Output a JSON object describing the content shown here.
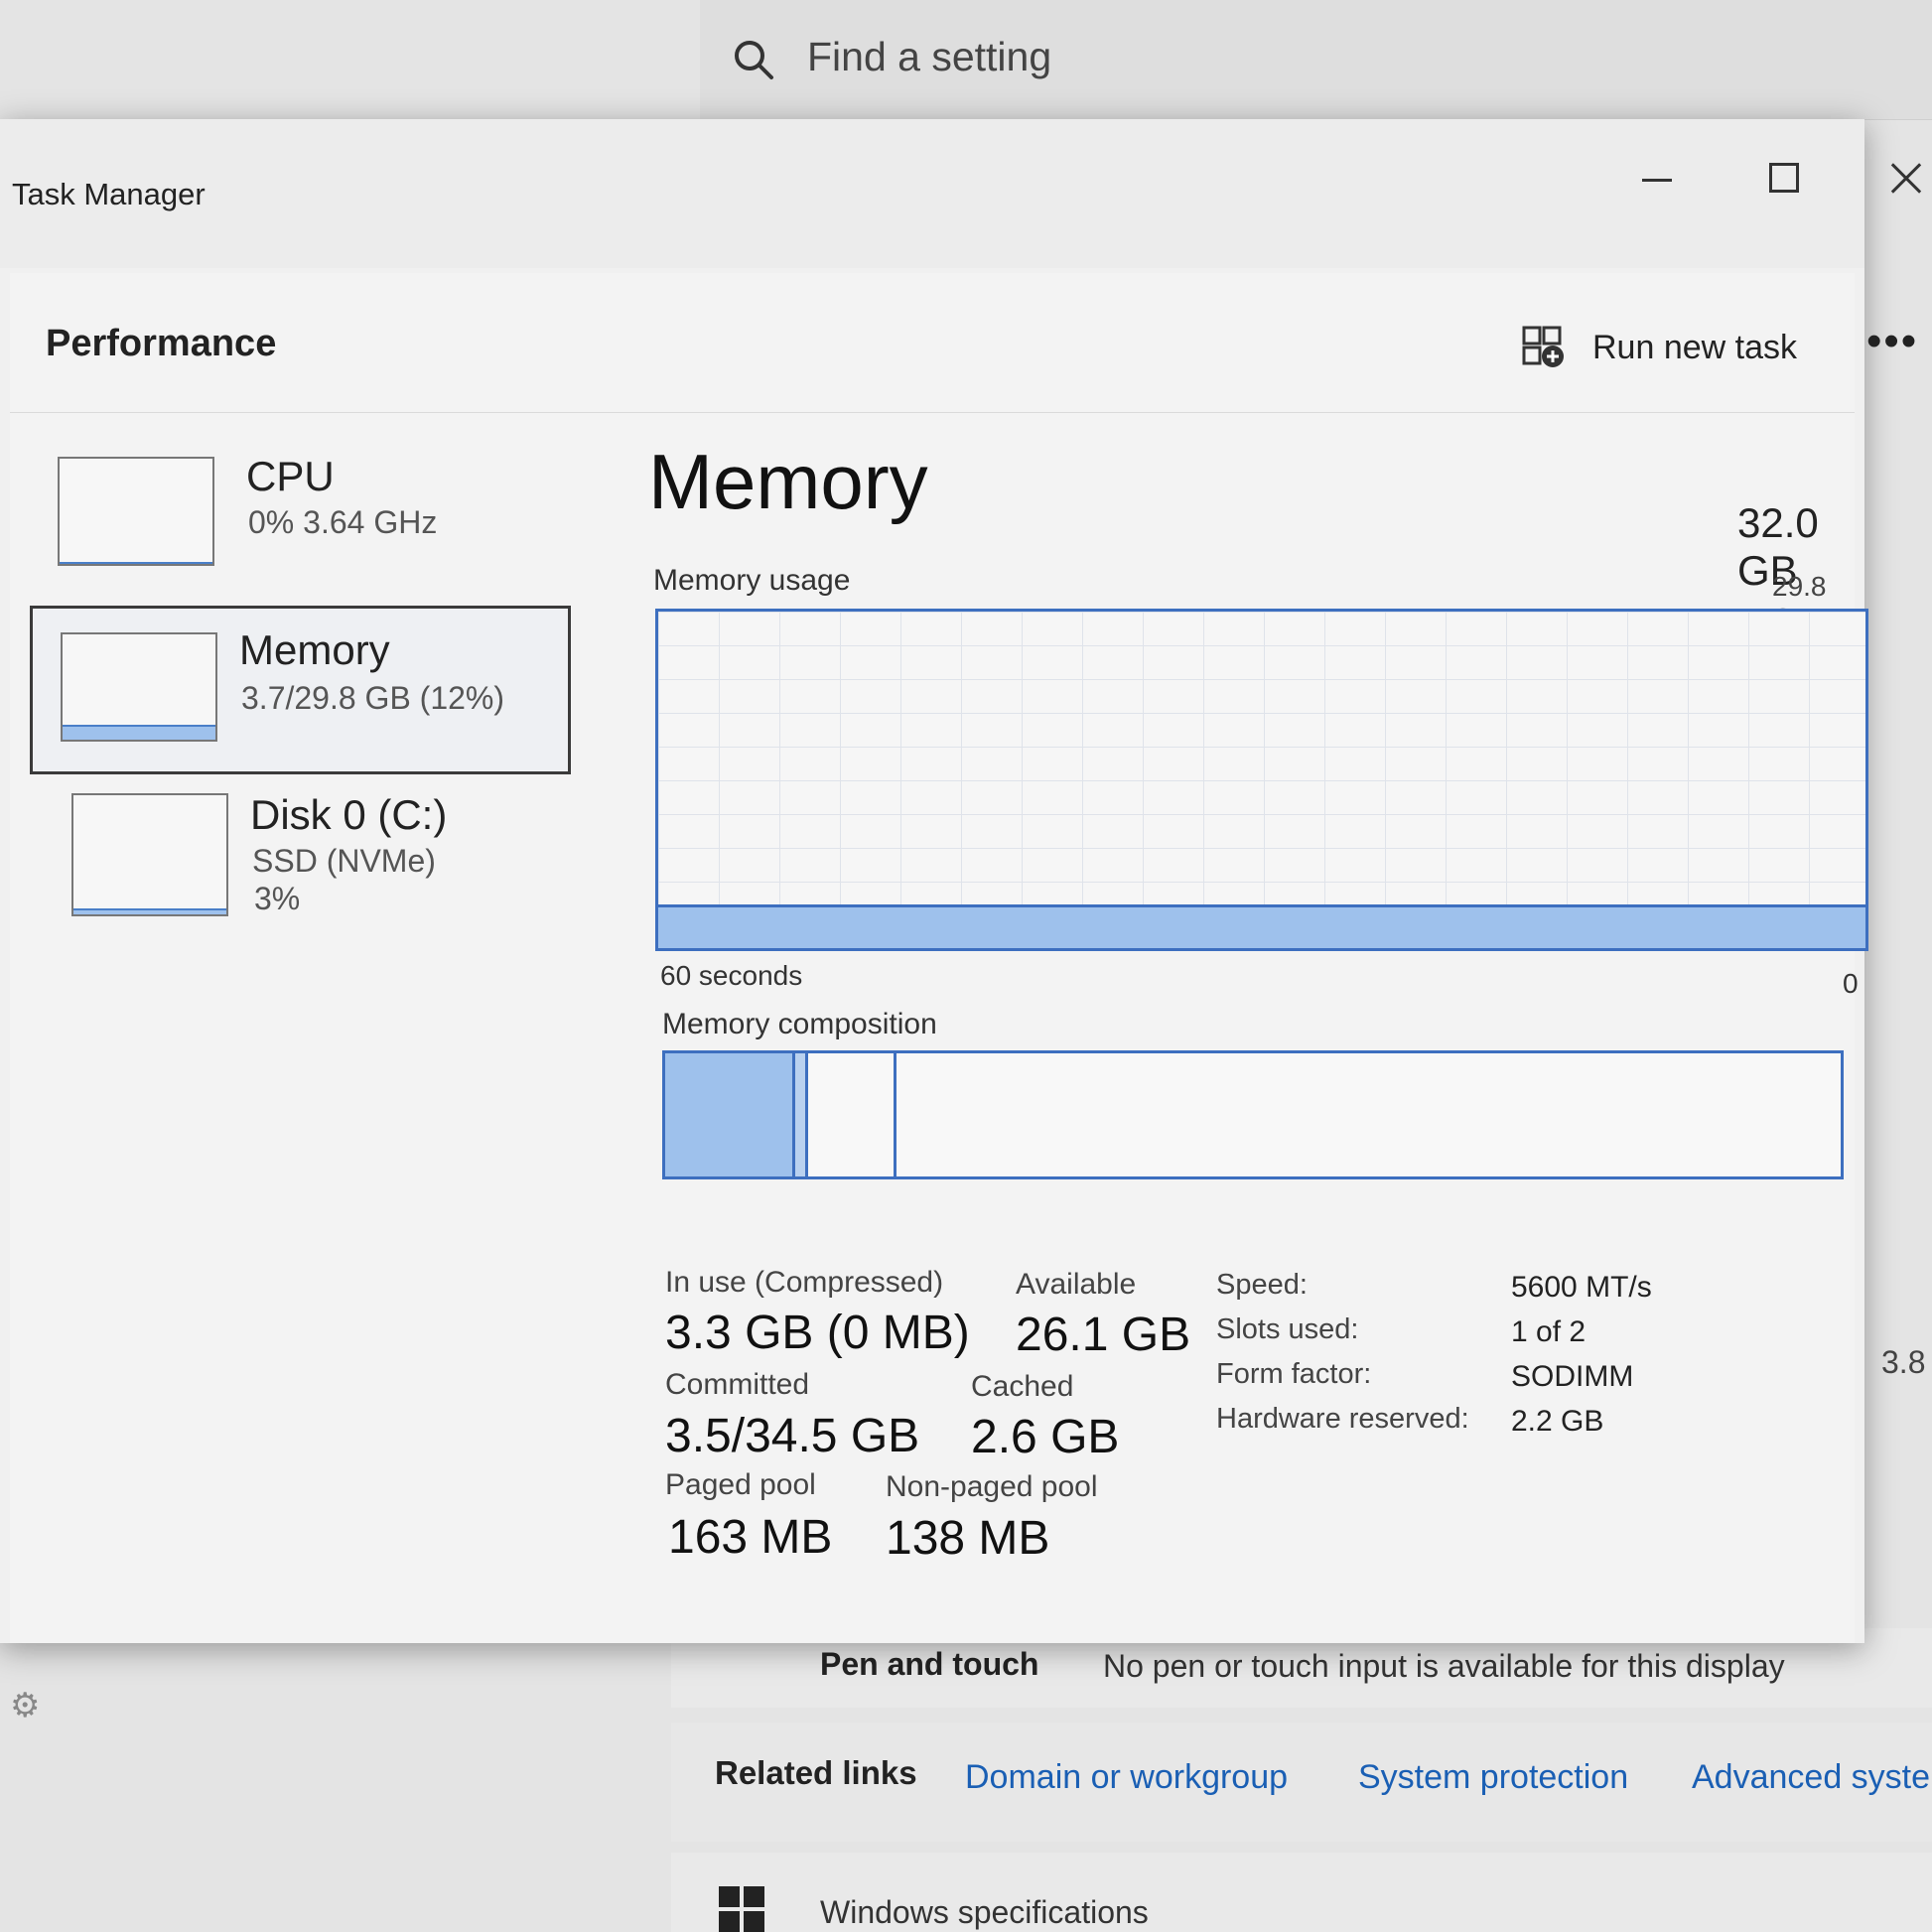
{
  "settings": {
    "search_placeholder": "Find a setting",
    "pen_label": "Pen and touch",
    "pen_value": "No pen or touch input is available for this display",
    "related_links_label": "Related links",
    "links": [
      "Domain or workgroup",
      "System protection",
      "Advanced system"
    ],
    "specs_label": "Windows specifications",
    "edge_text": "3.8"
  },
  "window": {
    "title": "Task Manager"
  },
  "header": {
    "title": "Performance",
    "run_new_task": "Run new task",
    "more": "•••"
  },
  "sidebar": {
    "items": [
      {
        "name": "CPU",
        "sub1": "0% 3.64 GHz",
        "sub2": "",
        "level": 0.0
      },
      {
        "name": "Memory",
        "sub1": "3.7/29.8 GB (12%)",
        "sub2": "",
        "level": 0.12
      },
      {
        "name": "Disk 0 (C:)",
        "sub1": "SSD (NVMe)",
        "sub2": "3%",
        "level": 0.03
      }
    ]
  },
  "memory": {
    "title": "Memory",
    "total": "32.0 GB",
    "usage_label": "Memory usage",
    "usage_max": "29.8 GB",
    "usage_level": 0.12,
    "time_left": "60 seconds",
    "time_right": "0",
    "composition_label": "Memory composition",
    "composition": [
      {
        "name": "in-use",
        "fraction": 0.111,
        "color": "#9ec1ec"
      },
      {
        "name": "modified",
        "fraction": 0.011,
        "color": "#b9d1ef"
      },
      {
        "name": "standby",
        "fraction": 0.075,
        "color": "#f8f8f8"
      },
      {
        "name": "free",
        "fraction": 0.803,
        "color": "#f8f8f8"
      }
    ],
    "stats": {
      "in_use_label": "In use (Compressed)",
      "in_use_value": "3.3 GB (0 MB)",
      "available_label": "Available",
      "available_value": "26.1 GB",
      "committed_label": "Committed",
      "committed_value": "3.5/34.5 GB",
      "cached_label": "Cached",
      "cached_value": "2.6 GB",
      "paged_label": "Paged pool",
      "paged_value": "163 MB",
      "nonpaged_label": "Non-paged pool",
      "nonpaged_value": "138 MB"
    },
    "specs": [
      {
        "label": "Speed:",
        "value": "5600 MT/s"
      },
      {
        "label": "Slots used:",
        "value": "1 of 2"
      },
      {
        "label": "Form factor:",
        "value": "SODIMM"
      },
      {
        "label": "Hardware reserved:",
        "value": "2.2 GB"
      }
    ]
  },
  "colors": {
    "accent": "#3d6fbf",
    "fill": "#9ec1ec",
    "link": "#1a5fb4"
  }
}
